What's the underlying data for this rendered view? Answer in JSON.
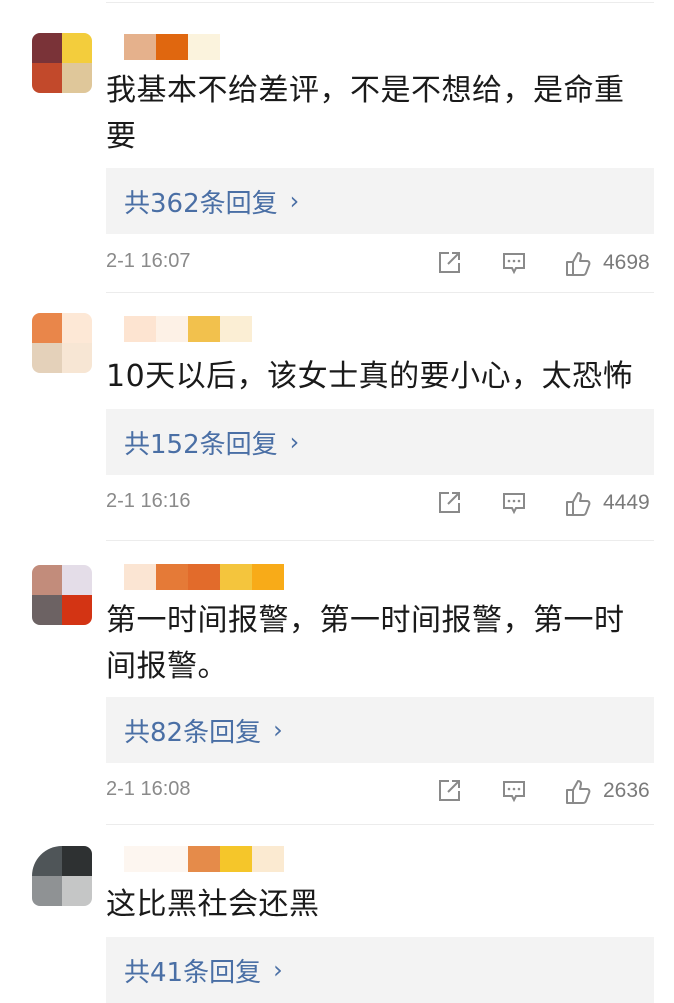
{
  "comments": [
    {
      "text": "我基本不给差评，不是不想给，是命重要",
      "replies": "共362条回复",
      "time": "2-1 16:07",
      "likes": "4698",
      "avatar_colors": [
        "#7a3338",
        "#f3cd3c",
        "#c2492b",
        "#dfc79a"
      ],
      "name_colors": [
        "#e5b18c",
        "#e0670f",
        "#fbf3dd"
      ]
    },
    {
      "text": "10天以后，该女士真的要小心，太恐怖",
      "replies": "共152条回复",
      "time": "2-1 16:16",
      "likes": "4449",
      "avatar_colors": [
        "#e9864a",
        "#fde8d6",
        "#e4d1ba",
        "#f7e6d4"
      ],
      "name_colors": [
        "#fde4d1",
        "#fdf1e6",
        "#f2c14d",
        "#fbeed4"
      ]
    },
    {
      "text": "第一时间报警，第一时间报警，第一时间报警。",
      "replies": "共82条回复",
      "time": "2-1 16:08",
      "likes": "2636",
      "avatar_colors": [
        "#c28c7b",
        "#e4dde8",
        "#6c6263",
        "#d33414"
      ],
      "name_colors": [
        "#fbe5d3",
        "#e57a37",
        "#e26b2b",
        "#f4c53d",
        "#f8ab18"
      ]
    },
    {
      "text": "这比黑社会还黑",
      "replies": "共41条回复",
      "time": "",
      "likes": "",
      "avatar_colors": [
        "#4f5558",
        "#2e3132",
        "#8f9294",
        "#c5c6c6"
      ],
      "name_colors": [
        "#fdf6f0",
        "#e58b4a",
        "#f5c62a",
        "#fbead1"
      ]
    }
  ],
  "icons": {
    "share": "share-icon",
    "comment": "comment-icon",
    "like": "thumbs-up-icon",
    "reply_chevron": "chevron-right-icon"
  },
  "colors": {
    "reply_link": "#4a6fa5",
    "reply_bg": "#f3f3f3",
    "meta_text": "#8a8a8a"
  }
}
